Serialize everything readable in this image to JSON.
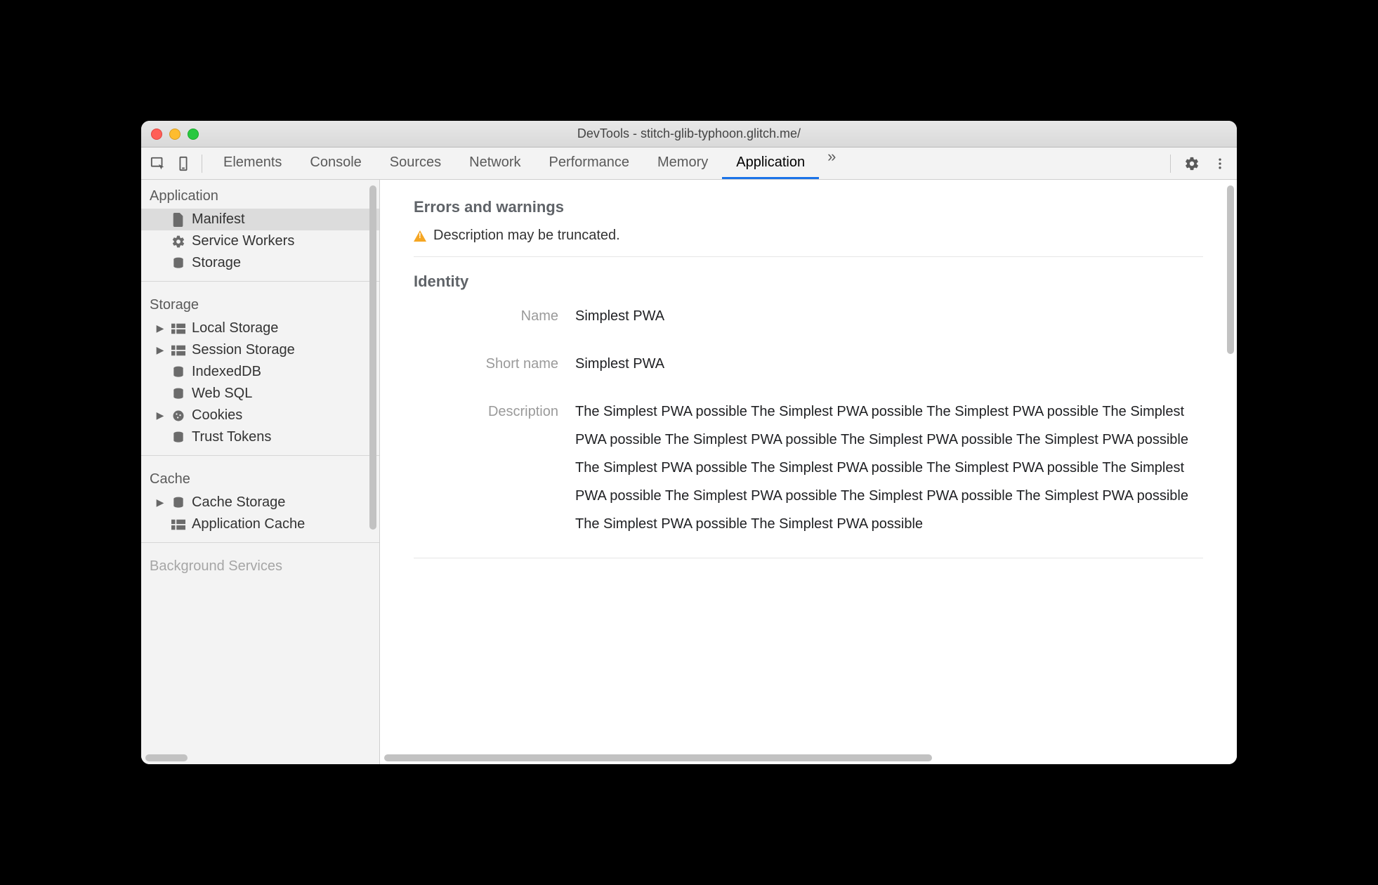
{
  "window": {
    "title": "DevTools - stitch-glib-typhoon.glitch.me/"
  },
  "tabs": {
    "items": [
      "Elements",
      "Console",
      "Sources",
      "Network",
      "Performance",
      "Memory",
      "Application"
    ],
    "active": "Application",
    "overflow_glyph": "»"
  },
  "sidebar": {
    "sections": [
      {
        "title": "Application",
        "items": [
          {
            "label": "Manifest",
            "icon": "file-icon",
            "selected": true
          },
          {
            "label": "Service Workers",
            "icon": "gear-icon"
          },
          {
            "label": "Storage",
            "icon": "database-icon"
          }
        ]
      },
      {
        "title": "Storage",
        "items": [
          {
            "label": "Local Storage",
            "icon": "grid-icon",
            "expandable": true
          },
          {
            "label": "Session Storage",
            "icon": "grid-icon",
            "expandable": true
          },
          {
            "label": "IndexedDB",
            "icon": "database-icon"
          },
          {
            "label": "Web SQL",
            "icon": "database-icon"
          },
          {
            "label": "Cookies",
            "icon": "cookie-icon",
            "expandable": true
          },
          {
            "label": "Trust Tokens",
            "icon": "database-icon"
          }
        ]
      },
      {
        "title": "Cache",
        "items": [
          {
            "label": "Cache Storage",
            "icon": "database-icon",
            "expandable": true
          },
          {
            "label": "Application Cache",
            "icon": "grid-icon"
          }
        ]
      },
      {
        "title": "Background Services",
        "items": []
      }
    ]
  },
  "main": {
    "errors_heading": "Errors and warnings",
    "warning_text": "Description may be truncated.",
    "identity_heading": "Identity",
    "identity": {
      "name_label": "Name",
      "name_value": "Simplest PWA",
      "short_name_label": "Short name",
      "short_name_value": "Simplest PWA",
      "description_label": "Description",
      "description_value": "The Simplest PWA possible The Simplest PWA possible The Simplest PWA possible The Simplest PWA possible The Simplest PWA possible The Simplest PWA possible The Simplest PWA possible The Simplest PWA possible The Simplest PWA possible The Simplest PWA possible The Simplest PWA possible The Simplest PWA possible The Simplest PWA possible The Simplest PWA possible The Simplest PWA possible The Simplest PWA possible"
    }
  }
}
